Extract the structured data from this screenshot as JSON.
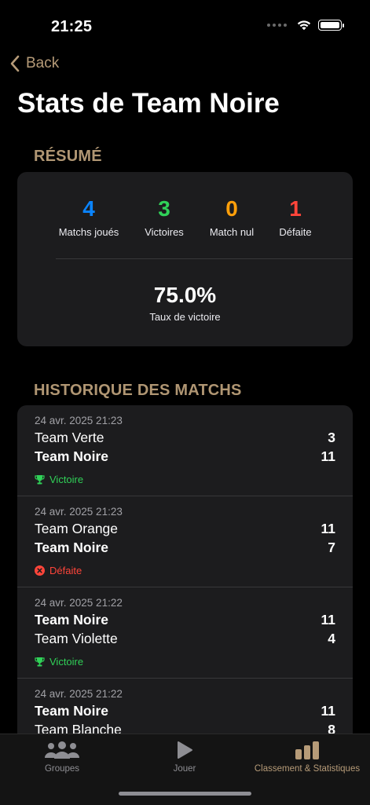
{
  "status_bar": {
    "time": "21:25"
  },
  "nav": {
    "back_label": "Back",
    "title": "Stats de Team Noire"
  },
  "summary": {
    "header": "RÉSUMÉ",
    "stats": [
      {
        "value": "4",
        "label": "Matchs joués",
        "color": "#0a84ff"
      },
      {
        "value": "3",
        "label": "Victoires",
        "color": "#30d158"
      },
      {
        "value": "0",
        "label": "Match nul",
        "color": "#ff9f0a"
      },
      {
        "value": "1",
        "label": "Défaite",
        "color": "#ff453a"
      }
    ],
    "win_rate": "75.0%",
    "win_rate_label": "Taux de victoire"
  },
  "history": {
    "header": "HISTORIQUE DES MATCHS",
    "matches": [
      {
        "date": "24 avr. 2025 21:23",
        "team1": {
          "name": "Team Verte",
          "score": "3"
        },
        "team2": {
          "name": "Team Noire",
          "score": "11"
        },
        "result": "Victoire",
        "result_color": "#30d158",
        "result_icon": "trophy-icon"
      },
      {
        "date": "24 avr. 2025 21:23",
        "team1": {
          "name": "Team Orange",
          "score": "11"
        },
        "team2": {
          "name": "Team Noire",
          "score": "7"
        },
        "result": "Défaite",
        "result_color": "#ff453a",
        "result_icon": "x-circle-icon"
      },
      {
        "date": "24 avr. 2025 21:22",
        "team1": {
          "name": "Team Noire",
          "score": "11"
        },
        "team2": {
          "name": "Team Violette",
          "score": "4"
        },
        "result": "Victoire",
        "result_color": "#30d158",
        "result_icon": "trophy-icon"
      },
      {
        "date": "24 avr. 2025 21:22",
        "team1": {
          "name": "Team Noire",
          "score": "11"
        },
        "team2": {
          "name": "Team Blanche",
          "score": "8"
        }
      }
    ]
  },
  "tabs": [
    {
      "label": "Groupes",
      "icon": "people-icon"
    },
    {
      "label": "Jouer",
      "icon": "play-icon"
    },
    {
      "label": "Classement & Statistiques",
      "icon": "bar-chart-icon",
      "selected": true
    }
  ],
  "colors": {
    "accent": "#b69b78",
    "tab_inactive": "#8e8e93",
    "tab_active": "#b69b78"
  }
}
